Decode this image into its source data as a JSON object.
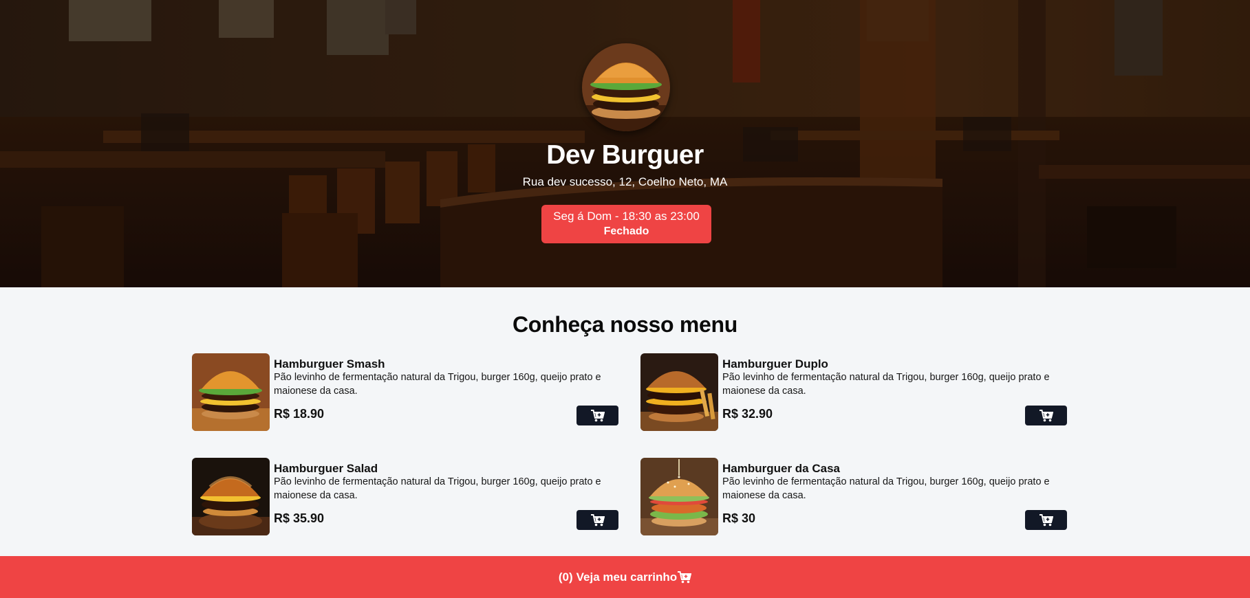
{
  "brand": {
    "name": "Dev Burguer",
    "address": "Rua dev sucesso, 12, Coelho Neto, MA",
    "hours": "Seg á Dom - 18:30 as 23:00",
    "status": "Fechado",
    "status_color": "#ef4444"
  },
  "menu": {
    "title": "Conheça nosso menu",
    "items": [
      {
        "name": "Hamburguer Smash",
        "description": "Pão levinho de fermentação natural da Trigou, burger 160g, queijo prato e maionese da casa.",
        "price": "R$ 18.90",
        "cart_icon": "cart-plus-icon"
      },
      {
        "name": "Hamburguer Duplo",
        "description": "Pão levinho de fermentação natural da Trigou, burger 160g, queijo prato e maionese da casa.",
        "price": "R$ 32.90",
        "cart_icon": "cart-plus-icon"
      },
      {
        "name": "Hamburguer Salad",
        "description": "Pão levinho de fermentação natural da Trigou, burger 160g, queijo prato e maionese da casa.",
        "price": "R$ 35.90",
        "cart_icon": "cart-plus-icon"
      },
      {
        "name": "Hamburguer da Casa",
        "description": "Pão levinho de fermentação natural da Trigou, burger 160g, queijo prato e maionese da casa.",
        "price": "R$ 30",
        "cart_icon": "cart-plus-icon"
      }
    ]
  },
  "cart": {
    "count": "(0)",
    "label": "Veja meu carrinho",
    "icon": "cart-icon",
    "bar_color": "#ef4444",
    "button_color": "#121826"
  }
}
